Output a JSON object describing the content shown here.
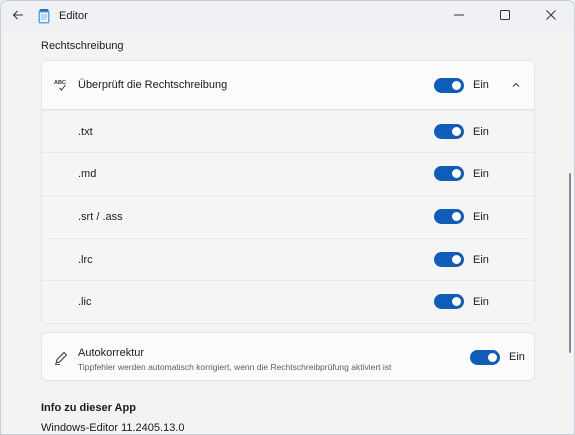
{
  "window": {
    "title": "Editor",
    "icons": {
      "back": "back-arrow-icon",
      "app": "notepad-icon",
      "minimize": "minimize-icon",
      "maximize": "maximize-icon",
      "close": "close-icon"
    }
  },
  "settings": {
    "section_title": "Rechtschreibung",
    "spellcheck": {
      "label": "Überprüft die Rechtschreibung",
      "toggle_state": "Ein",
      "icon": "spellcheck-icon",
      "expanded": true,
      "file_types": [
        {
          "label": ".txt",
          "toggle_state": "Ein"
        },
        {
          "label": ".md",
          "toggle_state": "Ein"
        },
        {
          "label": ".srt / .ass",
          "toggle_state": "Ein"
        },
        {
          "label": ".lrc",
          "toggle_state": "Ein"
        },
        {
          "label": ".lic",
          "toggle_state": "Ein"
        }
      ]
    },
    "autocorrect": {
      "title": "Autokorrektur",
      "description": "Tippfehler werden automatisch korrigiert, wenn die Rechtschreibprüfung aktiviert ist",
      "toggle_state": "Ein",
      "icon": "pen-icon"
    },
    "about": {
      "title": "Info zu dieser App",
      "version": "Windows-Editor 11.2405.13.0"
    }
  },
  "colors": {
    "accent": "#0f5db8",
    "background": "#f3f3f3",
    "card": "#fbfbfb"
  }
}
